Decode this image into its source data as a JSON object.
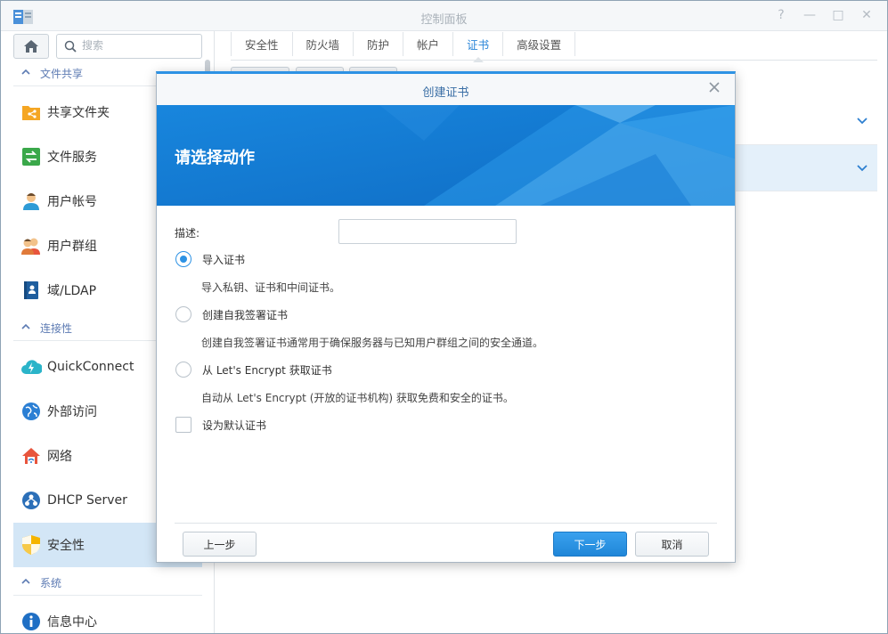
{
  "window": {
    "title": "控制面板",
    "controls": [
      "?",
      "—",
      "□",
      "✕"
    ]
  },
  "sidebar": {
    "search_placeholder": "搜索",
    "sections": [
      {
        "label": "文件共享",
        "items": [
          "共享文件夹",
          "文件服务",
          "用户帐号",
          "用户群组",
          "域/LDAP"
        ]
      },
      {
        "label": "连接性",
        "items": [
          "QuickConnect",
          "外部访问",
          "网络",
          "DHCP Server",
          "安全性"
        ]
      },
      {
        "label": "系统",
        "items": [
          "信息中心"
        ]
      }
    ],
    "active_item": "安全性"
  },
  "tabs": [
    "安全性",
    "防火墙",
    "防护",
    "帐户",
    "证书",
    "高级设置"
  ],
  "active_tab": "证书",
  "dialog": {
    "title": "创建证书",
    "banner_title": "请选择动作",
    "desc_label": "描述:",
    "desc_value": "",
    "options": [
      {
        "label": "导入证书",
        "desc": "导入私钥、证书和中间证书。",
        "checked": true
      },
      {
        "label": "创建自我签署证书",
        "desc": "创建自我签署证书通常用于确保服务器与已知用户群组之间的安全通道。",
        "checked": false
      },
      {
        "label": "从 Let's Encrypt 获取证书",
        "desc": "自动从 Let's Encrypt (开放的证书机构) 获取免费和安全的证书。",
        "checked": false
      }
    ],
    "default_cert_label": "设为默认证书",
    "default_cert_checked": false,
    "buttons": {
      "prev": "上一步",
      "next": "下一步",
      "cancel": "取消"
    }
  },
  "colors": {
    "accent": "#2d92e4",
    "active_bg": "#d3e6f6",
    "section_text": "#5d7bb3"
  }
}
